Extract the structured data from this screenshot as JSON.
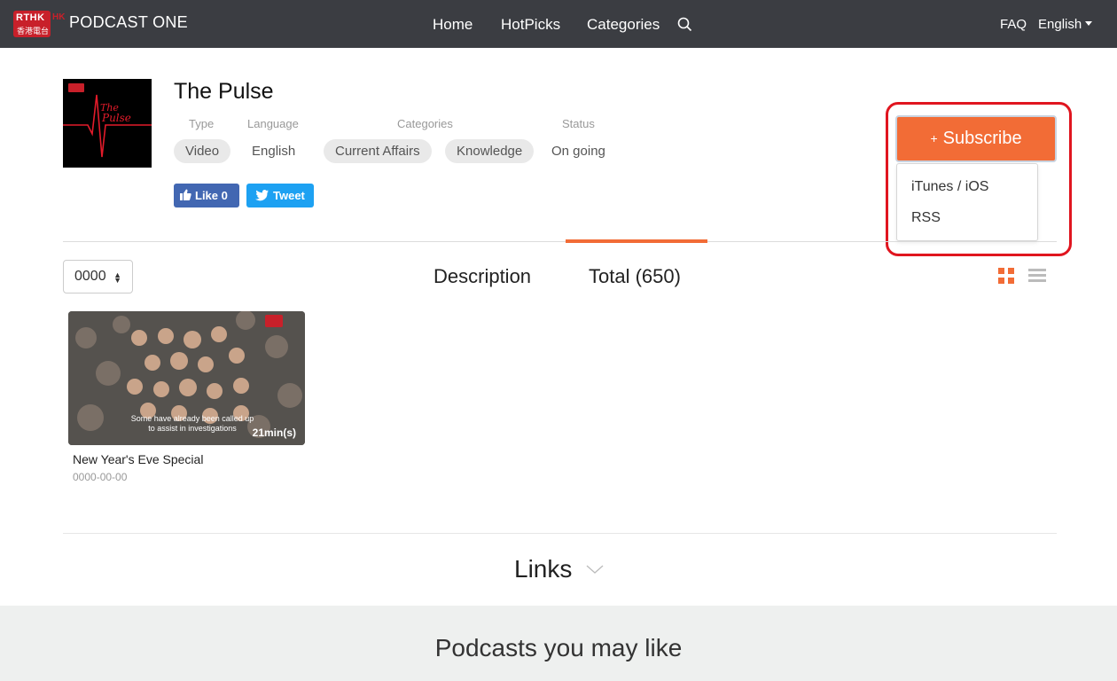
{
  "brand": {
    "logo_text": "RTHK",
    "logo_chinese": "香港電台",
    "logo_hk": "HK",
    "name": "PODCAST ONE"
  },
  "nav": {
    "items": [
      "Home",
      "HotPicks",
      "Categories"
    ],
    "faq": "FAQ",
    "language": "English"
  },
  "podcast": {
    "cover_text_1": "The",
    "cover_text_2": "Pulse",
    "title": "The Pulse",
    "labels": {
      "type": "Type",
      "language": "Language",
      "categories": "Categories",
      "status": "Status"
    },
    "type": "Video",
    "language": "English",
    "categories": [
      "Current Affairs",
      "Knowledge"
    ],
    "status": "On going"
  },
  "social": {
    "like": "Like 0",
    "tweet": "Tweet"
  },
  "subscribe": {
    "plus": "+",
    "label": "Subscribe",
    "options": [
      "iTunes / iOS",
      "RSS"
    ]
  },
  "tabs": {
    "year": "0000",
    "description": "Description",
    "total": "Total (650)",
    "active": "Total (650)"
  },
  "episodes": [
    {
      "title": "New Year's Eve Special",
      "date": "0000-00-00",
      "duration": "21min(s)",
      "caption": "Some have already been called up to assist in investigations"
    }
  ],
  "links": {
    "label": "Links"
  },
  "recommend": {
    "title": "Podcasts you may like"
  },
  "colors": {
    "accent": "#f26c36",
    "nav_bg": "#3b3d42",
    "highlight": "#e0151f",
    "facebook": "#4267b2",
    "twitter": "#1da1f2"
  },
  "icons": [
    "search-icon",
    "thumbs-up-icon",
    "twitter-bird-icon",
    "grid-view-icon",
    "list-view-icon",
    "chevron-down-icon",
    "sort-arrows-icon"
  ]
}
